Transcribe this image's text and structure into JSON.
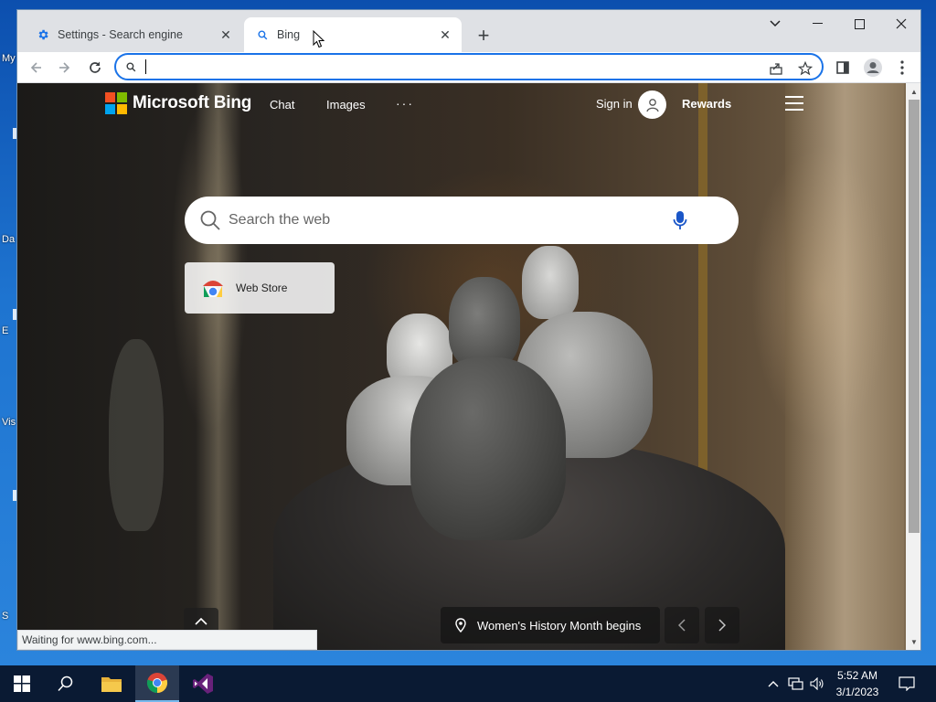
{
  "desktop": {
    "labels": [
      "My",
      "Da",
      "E",
      "Vis",
      "S"
    ]
  },
  "browser": {
    "tabs": [
      {
        "label": "Settings - Search engine",
        "icon": "gear-icon",
        "active": false
      },
      {
        "label": "Bing",
        "icon": "search-icon",
        "active": true
      }
    ],
    "omnibox": {
      "value": "",
      "placeholder": ""
    },
    "status": "Waiting for www.bing.com..."
  },
  "bing": {
    "brand": "Microsoft Bing",
    "nav": {
      "chat": "Chat",
      "images": "Images",
      "more": "···"
    },
    "sign_in": "Sign in",
    "rewards": "Rewards",
    "search_placeholder": "Search the web",
    "tile_label": "Web Store",
    "caption": "Women's History Month begins"
  },
  "taskbar": {
    "time": "5:52 AM",
    "date": "3/1/2023"
  },
  "colors": {
    "accent": "#1a73e8",
    "ms_red": "#f25022",
    "ms_green": "#7fba00",
    "ms_blue": "#00a4ef",
    "ms_yellow": "#ffb900"
  }
}
